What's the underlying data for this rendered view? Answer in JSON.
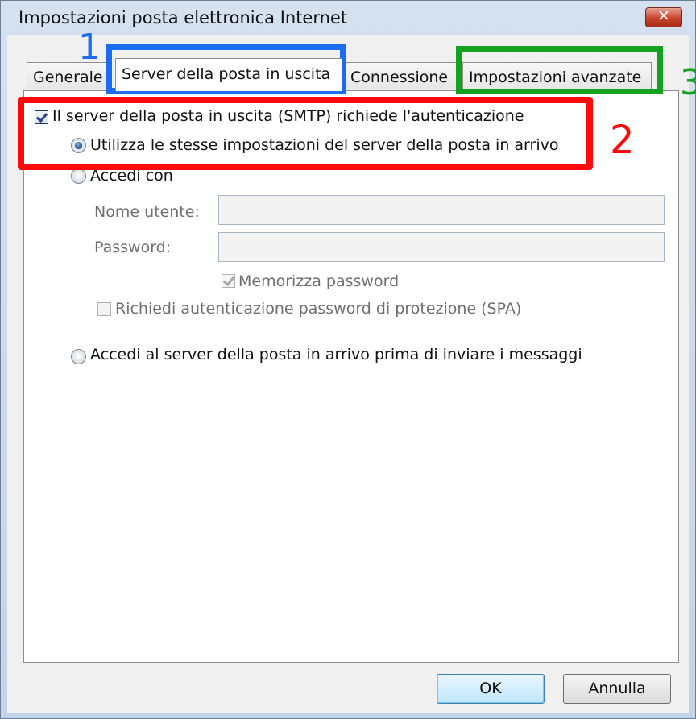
{
  "window": {
    "title": "Impostazioni posta elettronica Internet",
    "close_symbol": "✕"
  },
  "tabs": [
    {
      "label": "Generale",
      "active": false
    },
    {
      "label": "Server della posta in uscita",
      "active": true
    },
    {
      "label": "Connessione",
      "active": false
    },
    {
      "label": "Impostazioni avanzate",
      "active": false
    }
  ],
  "outgoing": {
    "smtp_auth_label": "Il server della posta in uscita (SMTP) richiede l'autenticazione",
    "smtp_auth_checked": true,
    "use_same_label": "Utilizza le stesse impostazioni del server della posta in arrivo",
    "use_same_selected": true,
    "login_with_label": "Accedi con",
    "login_with_selected": false,
    "username_label": "Nome utente:",
    "username_value": "",
    "password_label": "Password:",
    "password_value": "",
    "remember_password_label": "Memorizza password",
    "remember_password_checked": true,
    "spa_label": "Richiedi autenticazione password di protezione (SPA)",
    "spa_checked": false,
    "login_incoming_first_label": "Accedi al server della posta in arrivo prima di inviare i messaggi",
    "login_incoming_first_selected": false
  },
  "buttons": {
    "ok": "OK",
    "cancel": "Annulla"
  },
  "annotations": {
    "one": "1",
    "two": "2",
    "three": "3",
    "colors": {
      "one": "#1c6cf0",
      "two": "#ff0a0a",
      "three": "#14a11f"
    }
  }
}
